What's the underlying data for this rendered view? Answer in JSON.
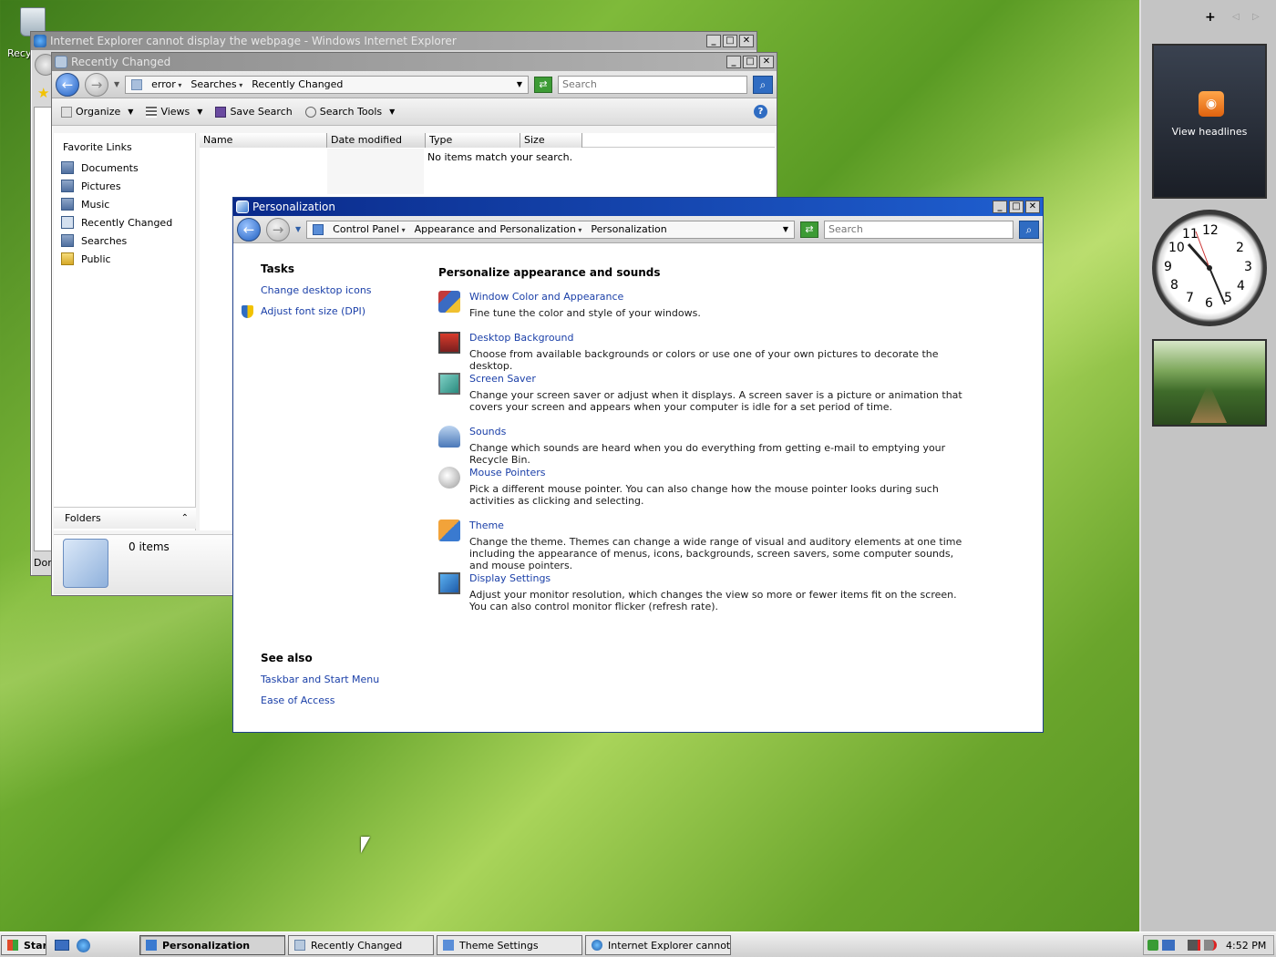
{
  "desktop": {
    "recycle_bin_label": "Recy"
  },
  "ie_window": {
    "title": "Internet Explorer cannot display the webpage - Windows Internet Explorer",
    "status_text": "Dor"
  },
  "explorer": {
    "title": "Recently Changed",
    "address": [
      "error",
      "Searches",
      "Recently Changed"
    ],
    "search_placeholder": "Search",
    "commands": {
      "organize": "Organize",
      "views": "Views",
      "save_search": "Save Search",
      "search_tools": "Search Tools"
    },
    "favorite_links_heading": "Favorite Links",
    "favorite_links": [
      "Documents",
      "Pictures",
      "Music",
      "Recently Changed",
      "Searches",
      "Public"
    ],
    "columns": [
      "Name",
      "Date modified",
      "Type",
      "Size"
    ],
    "empty_message": "No items match your search.",
    "folders_label": "Folders",
    "items_count": "0 items"
  },
  "personalization": {
    "title": "Personalization",
    "address": [
      "Control Panel",
      "Appearance and Personalization",
      "Personalization"
    ],
    "search_placeholder": "Search",
    "tasks_heading": "Tasks",
    "tasks": [
      "Change desktop icons",
      "Adjust font size (DPI)"
    ],
    "see_also_heading": "See also",
    "see_also": [
      "Taskbar and Start Menu",
      "Ease of Access"
    ],
    "main_heading": "Personalize appearance and sounds",
    "items": [
      {
        "title": "Window Color and Appearance",
        "desc": "Fine tune the color and style of your windows."
      },
      {
        "title": "Desktop Background",
        "desc": "Choose from available backgrounds or colors or use one of your own pictures to decorate the desktop."
      },
      {
        "title": "Screen Saver",
        "desc": "Change your screen saver or adjust when it displays. A screen saver is a picture or animation that covers your screen and appears when your computer is idle for a set period of time."
      },
      {
        "title": "Sounds",
        "desc": "Change which sounds are heard when you do everything from getting e-mail to emptying your Recycle Bin."
      },
      {
        "title": "Mouse Pointers",
        "desc": "Pick a different mouse pointer. You can also change how the mouse pointer looks during such activities as clicking and selecting."
      },
      {
        "title": "Theme",
        "desc": "Change the theme. Themes can change a wide range of visual and auditory elements at one time including the appearance of menus, icons, backgrounds, screen savers, some computer sounds, and mouse pointers."
      },
      {
        "title": "Display Settings",
        "desc": "Adjust your monitor resolution, which changes the view so more or fewer items fit on the screen. You can also control monitor flicker (refresh rate)."
      }
    ]
  },
  "sidebar_gadgets": {
    "feed_label": "View headlines",
    "add_symbol": "+",
    "clock_numbers": [
      "12",
      "2",
      "3",
      "4",
      "5",
      "6",
      "7",
      "8",
      "9",
      "10",
      "11"
    ]
  },
  "taskbar": {
    "start_label": "Start",
    "buttons": [
      "Personalization",
      "Recently Changed",
      "Theme Settings",
      "Internet Explorer cannot d..."
    ],
    "clock": "4:52 PM"
  }
}
